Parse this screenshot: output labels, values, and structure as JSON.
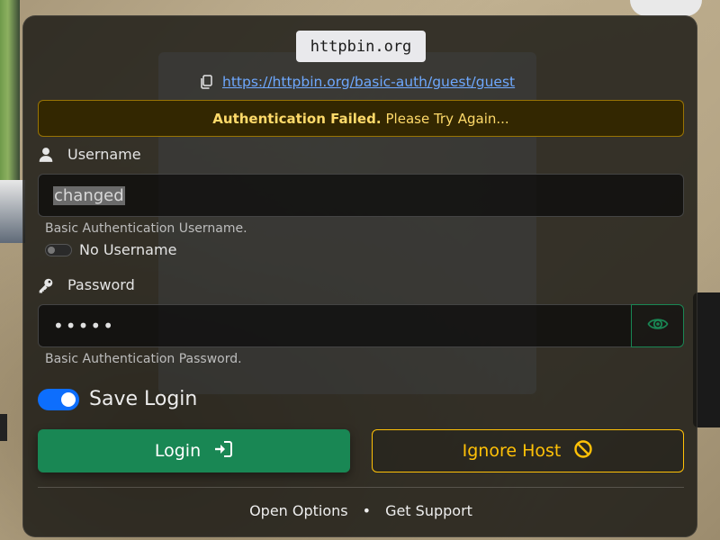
{
  "host_badge": "httpbin.org",
  "url": "https://httpbin.org/basic-auth/guest/guest",
  "alert": {
    "strong": "Authentication Failed.",
    "text": "Please Try Again..."
  },
  "username": {
    "label": "Username",
    "value": "changed",
    "help": "Basic Authentication Username.",
    "no_username_label": "No Username"
  },
  "password": {
    "label": "Password",
    "masked_value": "•••••",
    "help": "Basic Authentication Password."
  },
  "save_login_label": "Save Login",
  "buttons": {
    "login": "Login",
    "ignore": "Ignore Host"
  },
  "footer": {
    "open_options": "Open Options",
    "separator": "•",
    "get_support": "Get Support"
  },
  "icons": {
    "copy": "copy-icon",
    "user": "user-icon",
    "key": "key-icon",
    "eye": "eye-icon",
    "login": "sign-in-icon",
    "ignore": "ban-icon"
  },
  "colors": {
    "primary": "#0d6efd",
    "success": "#198754",
    "warning": "#ffc107",
    "link": "#6ea8fe"
  },
  "state": {
    "save_login": true,
    "no_username": false
  }
}
